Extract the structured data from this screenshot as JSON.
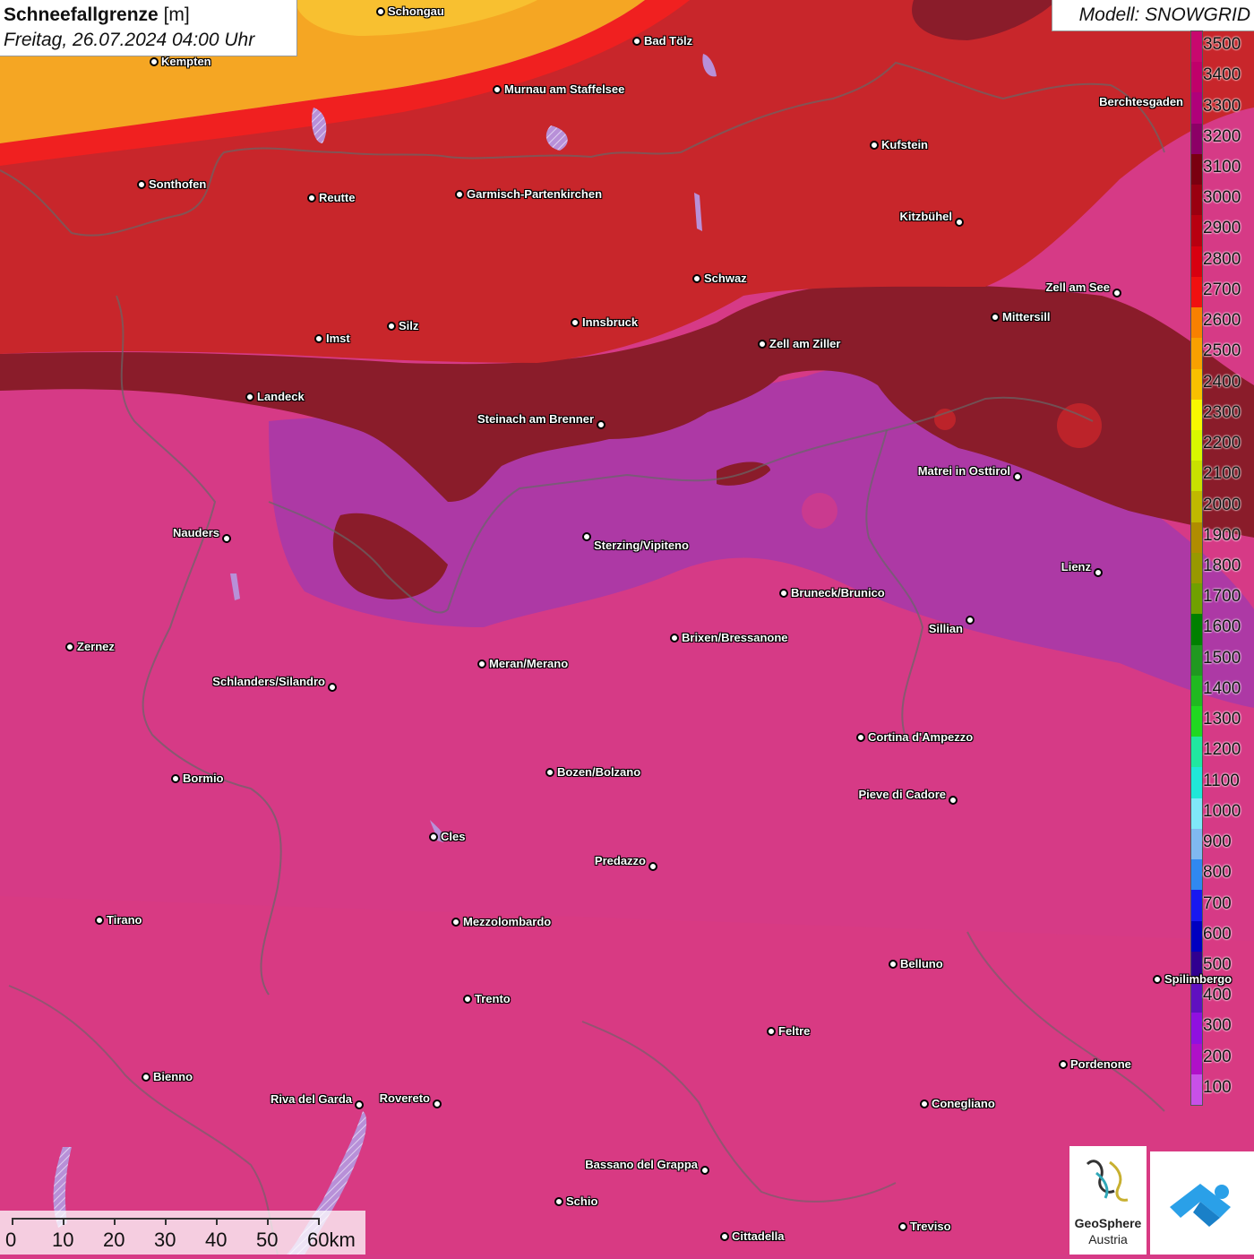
{
  "title": {
    "main": "Schneefallgrenze",
    "unit": "[m]",
    "subtitle": "Freitag, 26.07.2024 04:00 Uhr"
  },
  "model": "Modell: SNOWGRID",
  "legend": {
    "labels": [
      "3500",
      "3400",
      "3300",
      "3200",
      "3100",
      "3000",
      "2900",
      "2800",
      "2700",
      "2600",
      "2500",
      "2400",
      "2300",
      "2200",
      "2100",
      "2000",
      "1900",
      "1800",
      "1700",
      "1600",
      "1500",
      "1400",
      "1300",
      "1200",
      "1100",
      "1000",
      "900",
      "800",
      "700",
      "600",
      "500",
      "400",
      "300",
      "200",
      "100"
    ],
    "colors": [
      "#c8086e",
      "#c0006a",
      "#b0007a",
      "#8c0066",
      "#7a0010",
      "#9a0010",
      "#b80010",
      "#d80010",
      "#f01010",
      "#f88000",
      "#f8a000",
      "#f8c000",
      "#f8f800",
      "#d8f800",
      "#c8e000",
      "#c0b800",
      "#b08c00",
      "#989800",
      "#70a000",
      "#008000",
      "#209820",
      "#20b820",
      "#20d820",
      "#20e8a0",
      "#20e8d8",
      "#80e8f8",
      "#80b8f0",
      "#3088f0",
      "#1818f0",
      "#0000c0",
      "#300090",
      "#6010c0",
      "#9010e0",
      "#b010c8",
      "#c850e8"
    ]
  },
  "cities": [
    {
      "name": "Schongau"
    },
    {
      "name": "Bad Tölz"
    },
    {
      "name": "Kempten"
    },
    {
      "name": "Murnau am Staffelsee"
    },
    {
      "name": "Kufstein"
    },
    {
      "name": "Sonthofen"
    },
    {
      "name": "Reutte"
    },
    {
      "name": "Garmisch-Partenkirchen"
    },
    {
      "name": "Kitzbühel"
    },
    {
      "name": "Schwaz"
    },
    {
      "name": "Zell am See"
    },
    {
      "name": "Mittersill"
    },
    {
      "name": "Innsbruck"
    },
    {
      "name": "Silz"
    },
    {
      "name": "Imst"
    },
    {
      "name": "Zell am Ziller"
    },
    {
      "name": "Landeck"
    },
    {
      "name": "Steinach am Brenner"
    },
    {
      "name": "Matrei in Osttirol"
    },
    {
      "name": "Nauders"
    },
    {
      "name": "Sterzing/Vipiteno"
    },
    {
      "name": "Lienz"
    },
    {
      "name": "Bruneck/Brunico"
    },
    {
      "name": "Sillian"
    },
    {
      "name": "Zernez"
    },
    {
      "name": "Brixen/Bressanone"
    },
    {
      "name": "Meran/Merano"
    },
    {
      "name": "Schlanders/Silandro"
    },
    {
      "name": "Cortina d'Ampezzo"
    },
    {
      "name": "Bozen/Bolzano"
    },
    {
      "name": "Bormio"
    },
    {
      "name": "Pieve di Cadore"
    },
    {
      "name": "Cles"
    },
    {
      "name": "Predazzo"
    },
    {
      "name": "Tirano"
    },
    {
      "name": "Mezzolombardo"
    },
    {
      "name": "Belluno"
    },
    {
      "name": "Trento"
    },
    {
      "name": "Feltre"
    },
    {
      "name": "Pordenone"
    },
    {
      "name": "Bienno"
    },
    {
      "name": "Riva del Garda"
    },
    {
      "name": "Rovereto"
    },
    {
      "name": "Conegliano"
    },
    {
      "name": "Bassano del Grappa"
    },
    {
      "name": "Schio"
    },
    {
      "name": "Treviso"
    },
    {
      "name": "Cittadella"
    },
    {
      "name": "Berchtesgaden"
    },
    {
      "name": "Spilimbergo"
    }
  ],
  "scale": {
    "labels": [
      "0",
      "10",
      "20",
      "30",
      "40",
      "50",
      "60km"
    ]
  },
  "logos": {
    "geosphere_line1": "GeoSphere",
    "geosphere_line2": "Austria"
  },
  "colors": {
    "orange_zone": "#f5a623",
    "red_zone": "#c8262b",
    "dark_red_zone": "#8a1c2a",
    "purple_zone": "#a83aa8",
    "magenta_zone": "#d63a86"
  }
}
